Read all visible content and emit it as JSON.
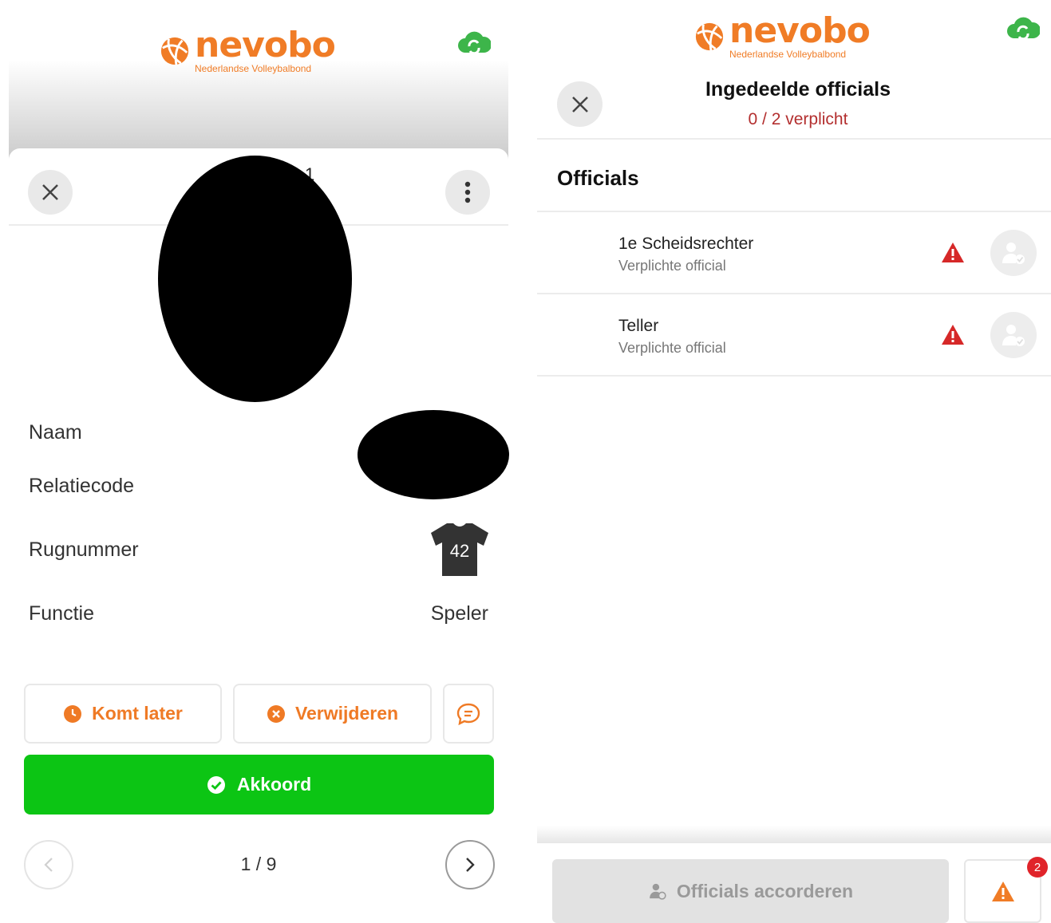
{
  "colors": {
    "brand_orange": "#f07c26",
    "accept_green": "#0cc514",
    "required_red": "#b32f2f",
    "warning_red": "#d62828",
    "warning_orange": "#f07c26"
  },
  "left": {
    "logo": {
      "word": "nevobo",
      "subtitle": "Nederlandse Volleybalbond"
    },
    "header": {
      "close_icon": "close-icon",
      "more_icon": "more-vertical-icon",
      "title_partial": "1"
    },
    "details": [
      {
        "label": "Naam",
        "value": ""
      },
      {
        "label": "Relatiecode",
        "value": ""
      },
      {
        "label": "Rugnummer",
        "value": "42"
      },
      {
        "label": "Functie",
        "value": "Speler"
      }
    ],
    "actions": {
      "later_label": "Komt later",
      "remove_label": "Verwijderen",
      "comment_icon": "comment-icon",
      "accept_label": "Akkoord"
    },
    "pager": {
      "text": "1 / 9",
      "prev_icon": "chevron-left-icon",
      "next_icon": "chevron-right-icon"
    }
  },
  "right": {
    "logo": {
      "word": "nevobo",
      "subtitle": "Nederlandse Volleybalbond"
    },
    "header": {
      "title": "Ingedeelde officials",
      "subtitle": "0 / 2 verplicht"
    },
    "section_title": "Officials",
    "officials": [
      {
        "name": "1e Scheidsrechter",
        "type": "Verplichte official"
      },
      {
        "name": "Teller",
        "type": "Verplichte official"
      }
    ],
    "footer": {
      "accord_label": "Officials accorderen",
      "badge_count": "2"
    }
  }
}
